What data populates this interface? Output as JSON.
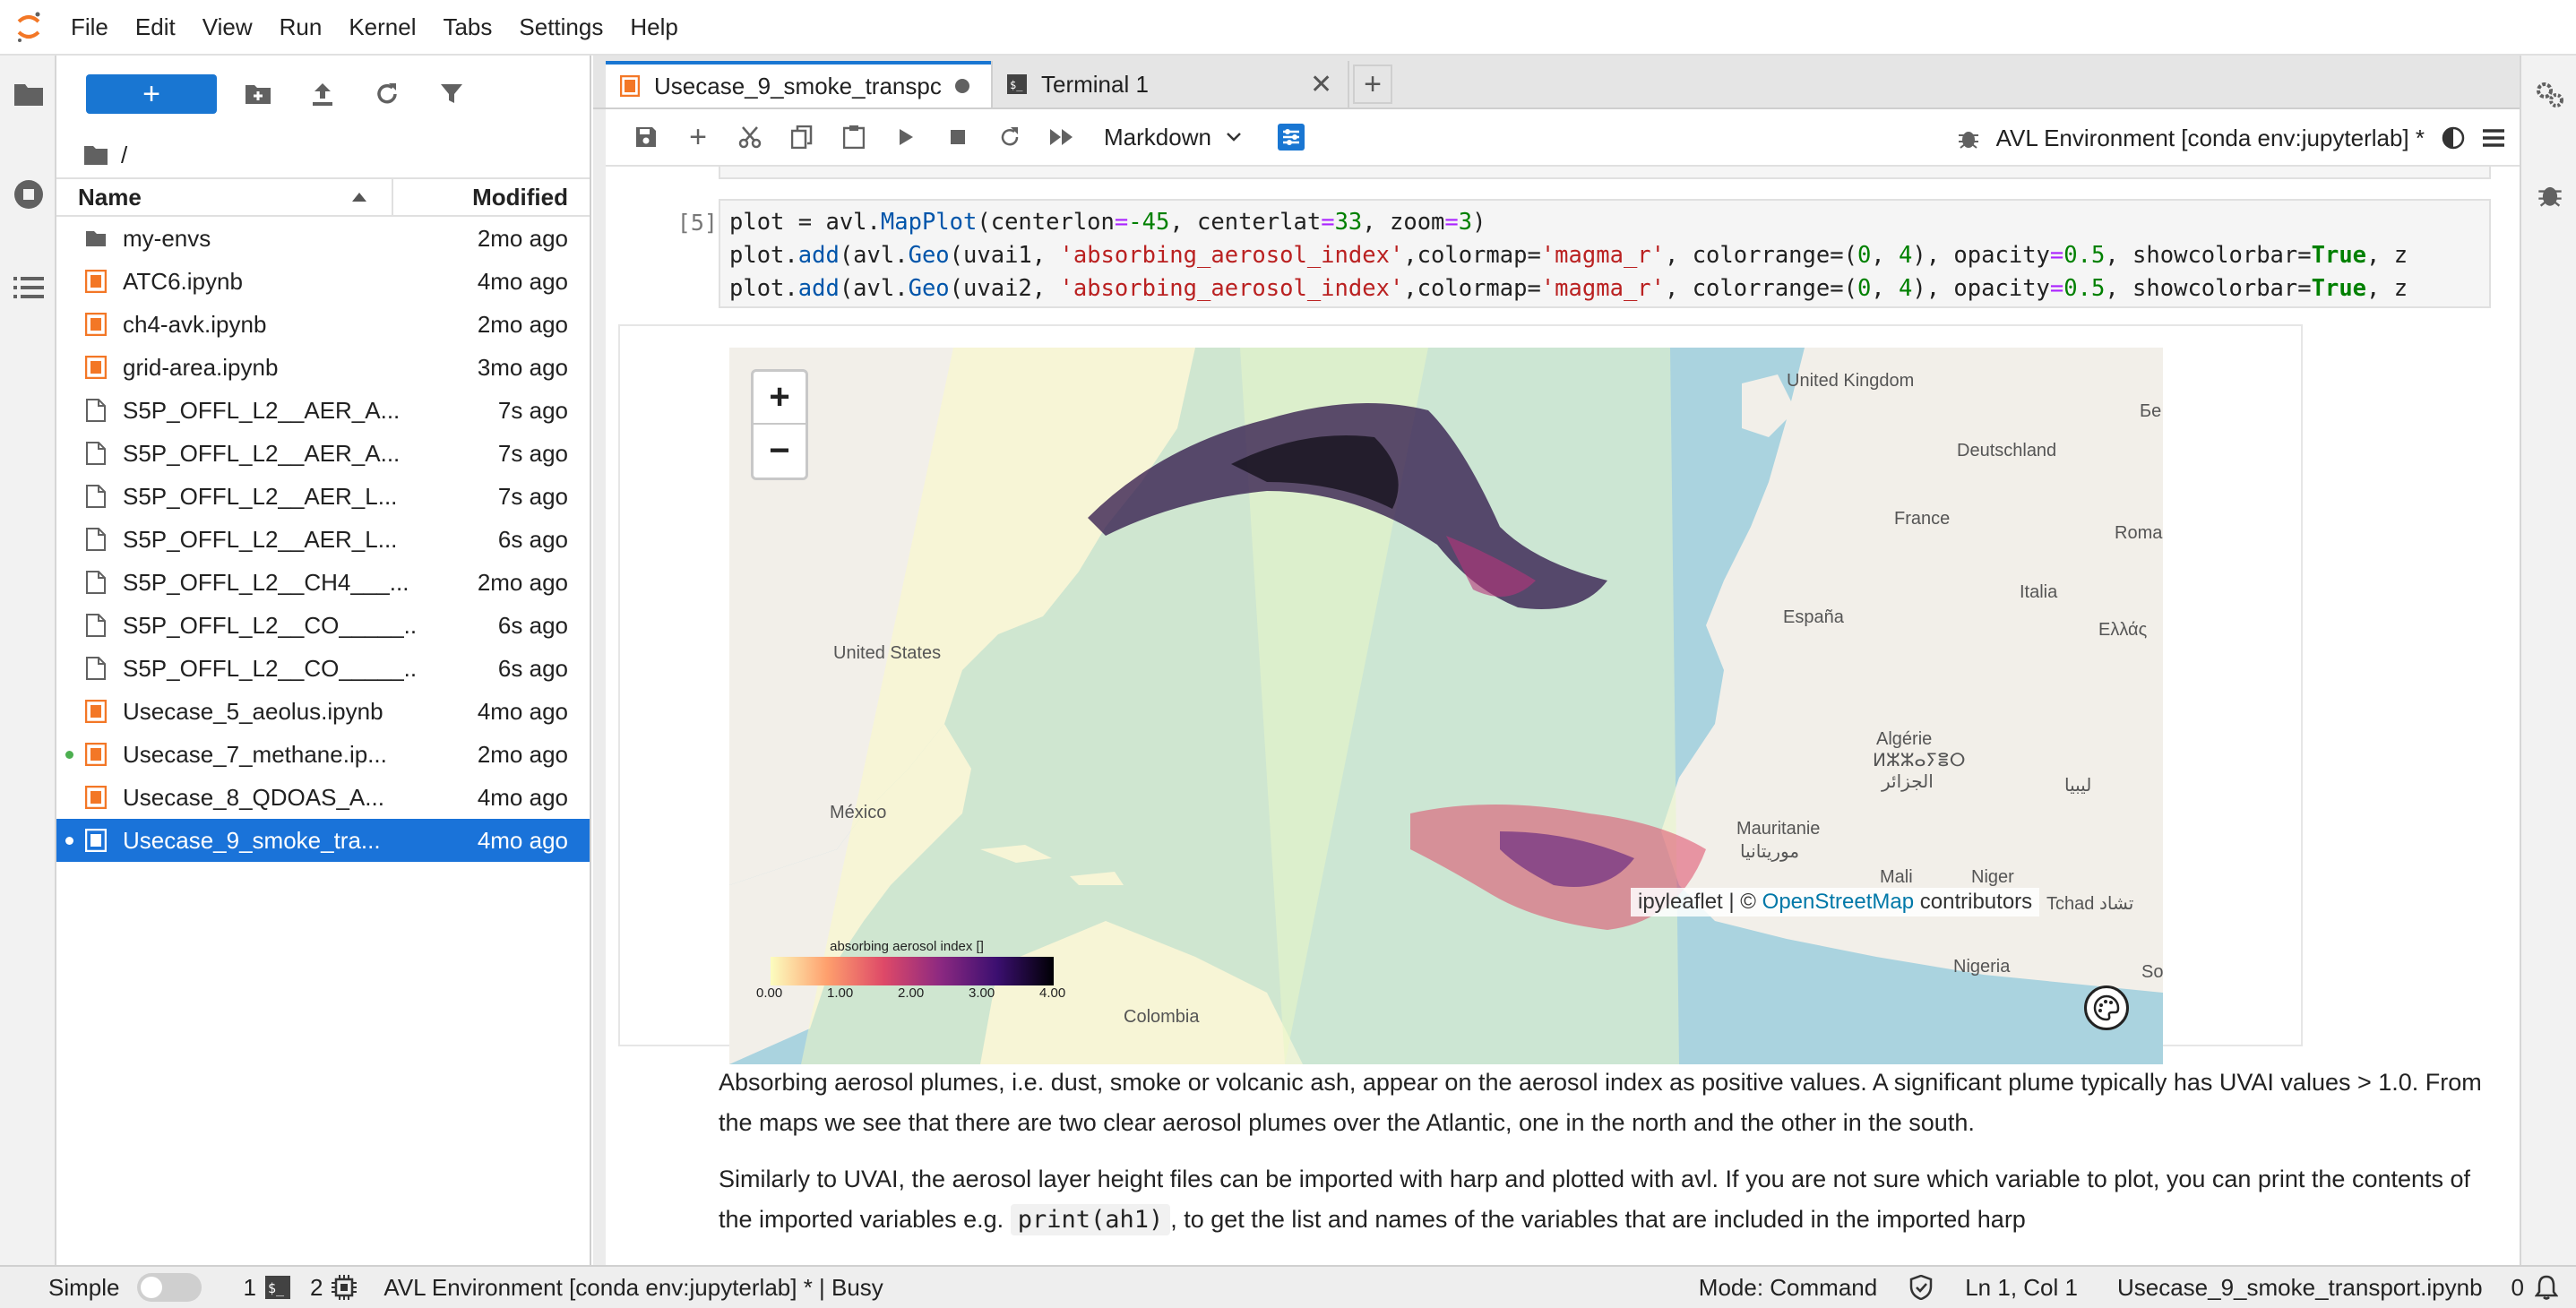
{
  "menubar": {
    "items": [
      "File",
      "Edit",
      "View",
      "Run",
      "Kernel",
      "Tabs",
      "Settings",
      "Help"
    ]
  },
  "filebrowser": {
    "new_label": "+",
    "breadcrumb": "/",
    "columns": {
      "name": "Name",
      "modified": "Modified"
    },
    "files": [
      {
        "name": "my-envs",
        "modified": "2mo ago",
        "type": "folder",
        "running": false,
        "selected": false
      },
      {
        "name": "ATC6.ipynb",
        "modified": "4mo ago",
        "type": "notebook",
        "running": false,
        "selected": false
      },
      {
        "name": "ch4-avk.ipynb",
        "modified": "2mo ago",
        "type": "notebook",
        "running": false,
        "selected": false
      },
      {
        "name": "grid-area.ipynb",
        "modified": "3mo ago",
        "type": "notebook",
        "running": false,
        "selected": false
      },
      {
        "name": "S5P_OFFL_L2__AER_A...",
        "modified": "7s ago",
        "type": "file",
        "running": false,
        "selected": false
      },
      {
        "name": "S5P_OFFL_L2__AER_A...",
        "modified": "7s ago",
        "type": "file",
        "running": false,
        "selected": false
      },
      {
        "name": "S5P_OFFL_L2__AER_L...",
        "modified": "7s ago",
        "type": "file",
        "running": false,
        "selected": false
      },
      {
        "name": "S5P_OFFL_L2__AER_L...",
        "modified": "6s ago",
        "type": "file",
        "running": false,
        "selected": false
      },
      {
        "name": "S5P_OFFL_L2__CH4___...",
        "modified": "2mo ago",
        "type": "file",
        "running": false,
        "selected": false
      },
      {
        "name": "S5P_OFFL_L2__CO_____...",
        "modified": "6s ago",
        "type": "file",
        "running": false,
        "selected": false
      },
      {
        "name": "S5P_OFFL_L2__CO_____...",
        "modified": "6s ago",
        "type": "file",
        "running": false,
        "selected": false
      },
      {
        "name": "Usecase_5_aeolus.ipynb",
        "modified": "4mo ago",
        "type": "notebook",
        "running": false,
        "selected": false
      },
      {
        "name": "Usecase_7_methane.ip...",
        "modified": "2mo ago",
        "type": "notebook",
        "running": true,
        "selected": false
      },
      {
        "name": "Usecase_8_QDOAS_A...",
        "modified": "4mo ago",
        "type": "notebook",
        "running": false,
        "selected": false
      },
      {
        "name": "Usecase_9_smoke_tra...",
        "modified": "4mo ago",
        "type": "notebook",
        "running": true,
        "selected": true
      }
    ]
  },
  "tabs": [
    {
      "label": "Usecase_9_smoke_transpc",
      "active": true
    },
    {
      "label": "Terminal 1",
      "active": false
    }
  ],
  "toolbar": {
    "cell_type": "Markdown",
    "kernel_name": "AVL Environment [conda env:jupyterlab] *"
  },
  "cell": {
    "prompt": "[5]:",
    "code_lines": [
      "plot = avl.MapPlot(centerlon=-45, centerlat=33, zoom=3)",
      "plot.add(avl.Geo(uvai1, 'absorbing_aerosol_index',colormap='magma_r', colorrange=(0, 4), opacity=0.5, showcolorbar=True, z",
      "plot.add(avl.Geo(uvai2, 'absorbing_aerosol_index',colormap='magma_r', colorrange=(0, 4), opacity=0.5, showcolorbar=True, z"
    ]
  },
  "map": {
    "zoom_in": "+",
    "zoom_out": "−",
    "colorbar_title": "absorbing aerosol index []",
    "colorbar_ticks": [
      "0.00",
      "1.00",
      "2.00",
      "3.00",
      "4.00"
    ],
    "attribution_prefix": "ipyleaflet | © ",
    "attribution_link": "OpenStreetMap",
    "attribution_suffix": " contributors",
    "labels": [
      "United Kingdom",
      "Deutschland",
      "France",
      "Roma",
      "España",
      "Italia",
      "Ελλάς",
      "United States",
      "Algérie",
      "ⵍⵣⵣⴰⵢⴻⵔ",
      "الجزائر",
      "ليبيا",
      "México",
      "Mauritanie",
      "موريتانيا",
      "Mali",
      "Niger",
      "Tchad تشاد",
      "Nigeria",
      "Colombia",
      "Бе",
      "So"
    ]
  },
  "markdown": {
    "p1": "Absorbing aerosol plumes, i.e. dust, smoke or volcanic ash, appear on the aerosol index as positive values. A significant plume typically has UVAI values > 1.0. From the maps we see that there are two clear aerosol plumes over the Atlantic, one in the north and the other in the south.",
    "p2_a": "Similarly to UVAI, the aerosol layer height files can be imported with harp and plotted with avl. If you are not sure which variable to plot, you can print the contents of the imported variables e.g. ",
    "p2_code": "print(ah1)",
    "p2_b": ", to get the list and names of the variables that are included in the imported harp"
  },
  "statusbar": {
    "mode_label": "Simple",
    "terminals_count": "1",
    "kernels_count": "2",
    "kernel_status": "AVL Environment [conda env:jupyterlab] * | Busy",
    "mode": "Mode: Command",
    "cursor": "Ln 1, Col 1",
    "filename": "Usecase_9_smoke_transport.ipynb",
    "notifications": "0"
  },
  "colors": {
    "accent": "#1976d2",
    "selected_row": "#1a73d9",
    "notebook_icon": "#f37726",
    "running_dot": "#4caf50"
  }
}
